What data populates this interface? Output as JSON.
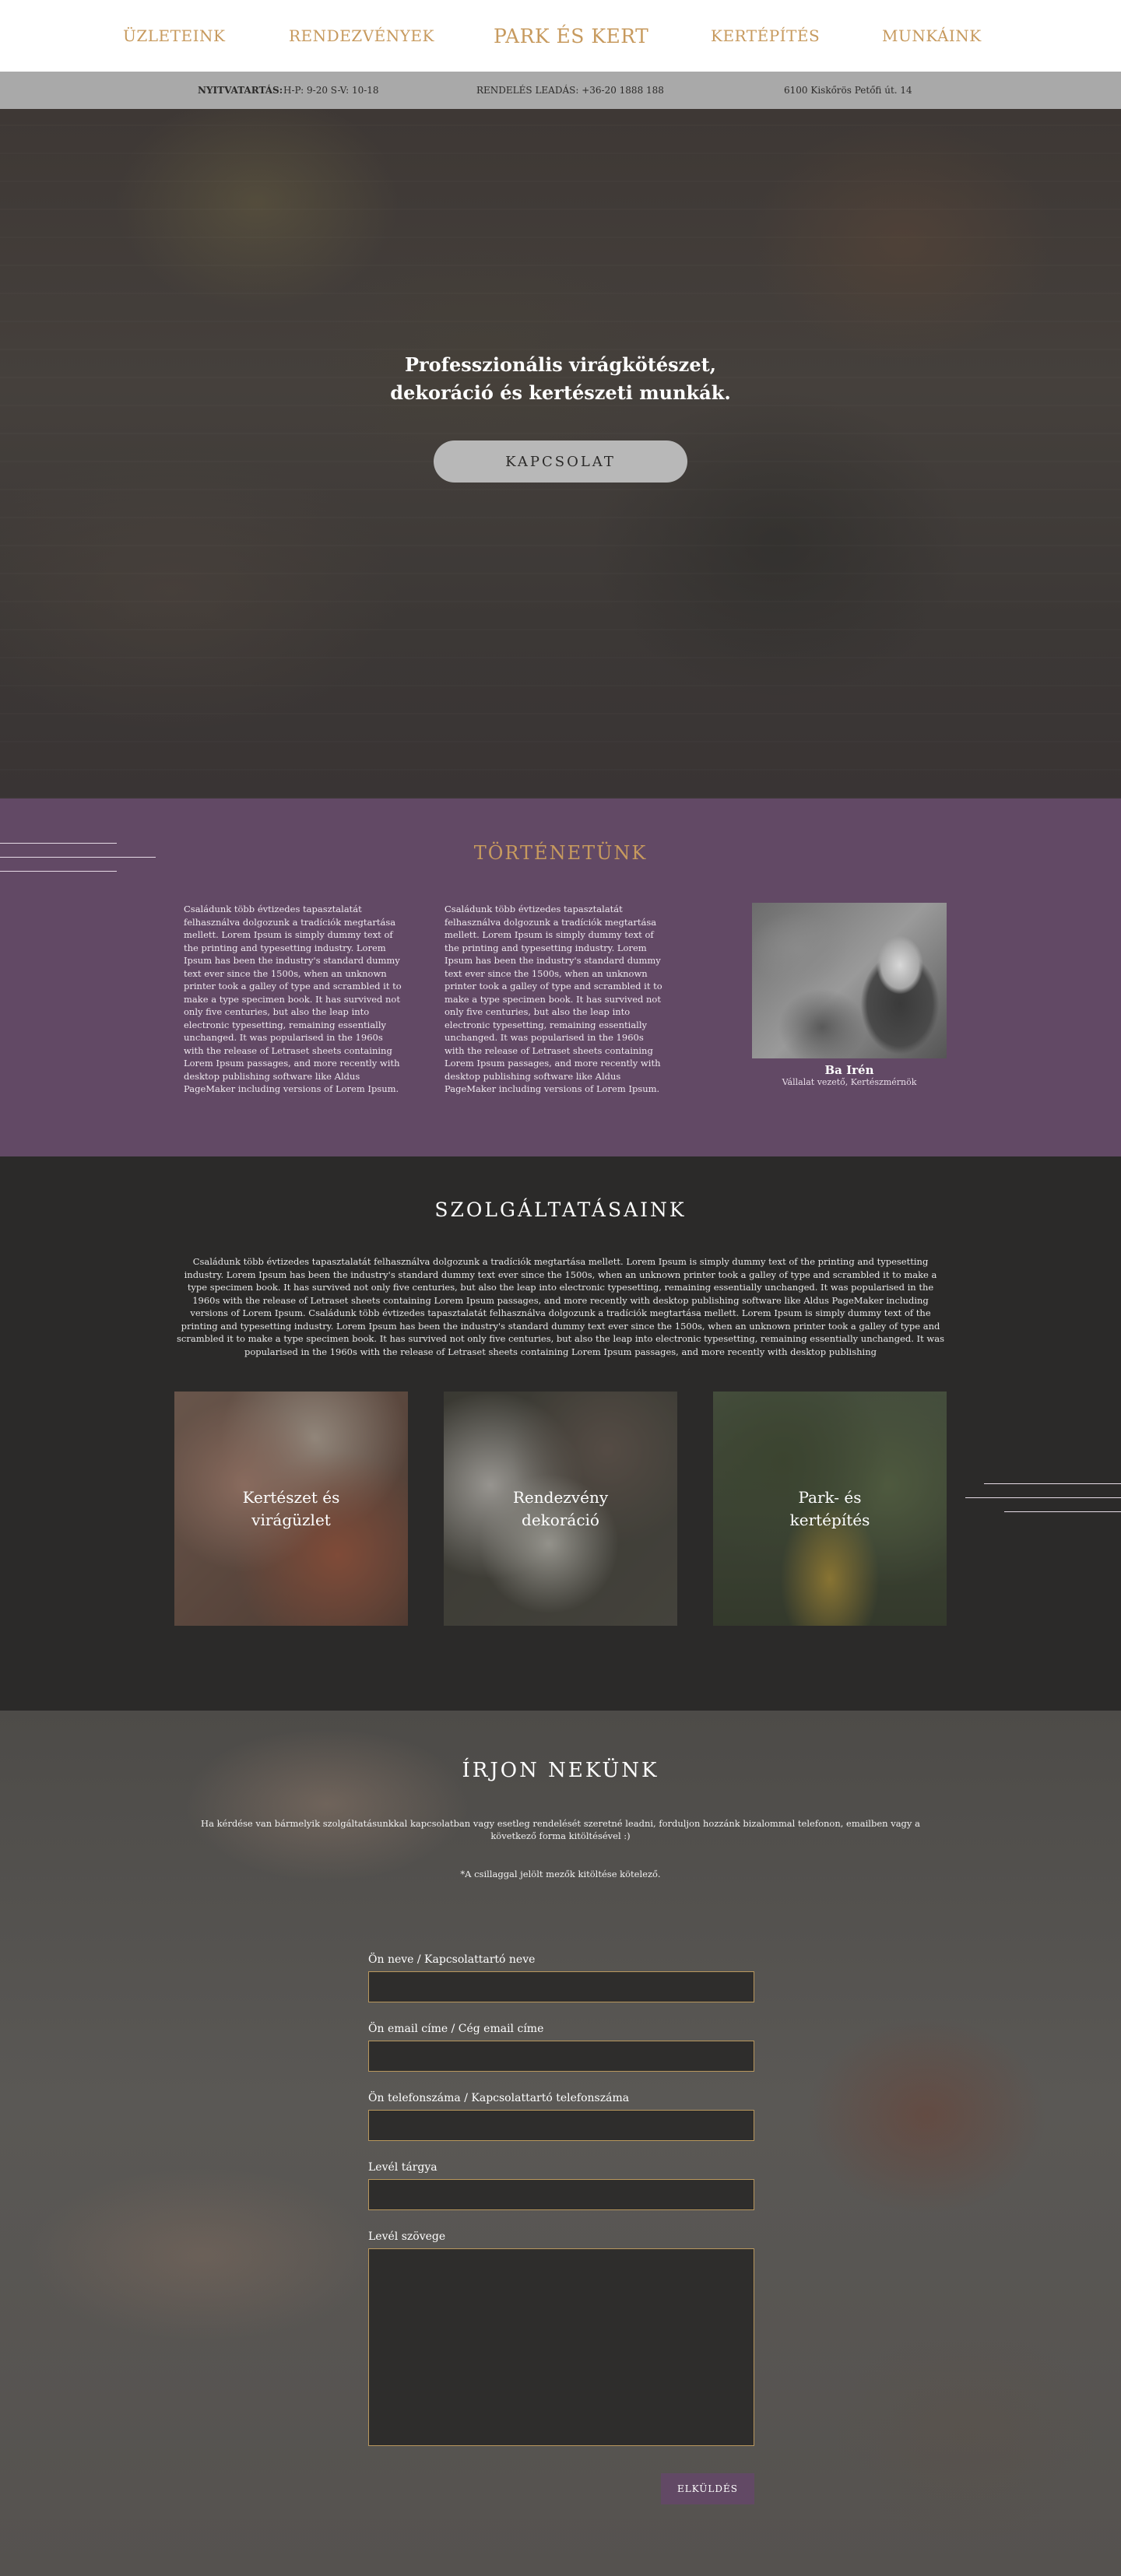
{
  "nav": {
    "items": [
      "ÜZLETEINK",
      "RENDEZVÉNYEK",
      "PARK ÉS KERT",
      "KERTÉPÍTÉS",
      "MUNKÁINK"
    ]
  },
  "infobar": {
    "hours_label": "NYITVATARTÁS:",
    "hours_value": "H-P: 9-20 S-V: 10-18",
    "order": "RENDELÉS LEADÁS: +36-20 1888 188",
    "address": "6100 Kiskőrös Petőfi út. 14"
  },
  "hero": {
    "title": "Professzionális virágkötészet, dekoráció és kertészeti munkák.",
    "button": "KAPCSOLAT"
  },
  "story": {
    "title": "TÖRTÉNETÜNK",
    "col1": "Családunk több évtizedes tapasztalatát  felhasználva dolgozunk a tradíciók megtartása mellett. Lorem Ipsum is simply dummy text of the printing and typesetting industry. Lorem Ipsum has been the industry's standard dummy text ever since the 1500s, when an unknown printer took a galley of type and scrambled it to make a type specimen book. It has survived not only five centuries, but also the leap into electronic typesetting, remaining essentially unchanged. It was popularised in the 1960s with the release of Letraset sheets containing Lorem Ipsum passages, and more recently with desktop publishing software like Aldus PageMaker including versions of Lorem Ipsum.",
    "col2": "Családunk több évtizedes tapasztalatát  felhasználva dolgozunk a tradíciók megtartása mellett. Lorem Ipsum is simply dummy text of the printing and typesetting industry. Lorem Ipsum has been the industry's standard dummy text ever since the 1500s, when an unknown printer took a galley of type and scrambled it to make a type specimen book. It has survived not only five centuries, but also the leap into electronic typesetting, remaining essentially unchanged. It was popularised in the 1960s with the release of Letraset sheets containing Lorem Ipsum passages, and more recently with desktop publishing software like Aldus PageMaker including versions of Lorem Ipsum.",
    "person_name": "Ba Irén",
    "person_role": "Vállalat vezető, Kertészmérnök"
  },
  "services": {
    "title": "SZOLGÁLTATÁSAINK",
    "text": "Családunk több évtizedes tapasztalatát  felhasználva dolgozunk a tradíciók megtartása mellett. Lorem Ipsum is simply dummy text of the printing and typesetting industry. Lorem Ipsum has been the industry's standard dummy text ever since the 1500s, when an unknown printer took a galley of type and scrambled it to make a type specimen book. It has survived not only five centuries, but also the leap into electronic typesetting, remaining essentially unchanged. It was popularised in the 1960s with the release of Letraset sheets containing Lorem Ipsum passages, and more recently with desktop publishing software like Aldus PageMaker including versions of Lorem Ipsum.  Családunk több évtizedes tapasztalatát  felhasználva dolgozunk a tradíciók megtartása mellett. Lorem Ipsum is simply dummy text of the printing and typesetting industry. Lorem Ipsum has been the industry's standard dummy text ever since the 1500s, when an unknown printer took a galley of type and scrambled it to make a type specimen book. It has survived not only five centuries, but also the leap into electronic typesetting, remaining essentially unchanged. It was popularised in the 1960s with the release of Letraset sheets containing Lorem Ipsum passages, and more recently with desktop publishing",
    "cards": [
      {
        "line1": "Kertészet és",
        "line2": "virágüzlet"
      },
      {
        "line1": "Rendezvény",
        "line2": "dekoráció"
      },
      {
        "line1": "Park- és",
        "line2": "kertépítés"
      }
    ]
  },
  "contact": {
    "title": "ÍRJON NEKÜNK",
    "intro": "Ha kérdése van bármelyik szolgáltatásunkkal kapcsolatban vagy esetleg rendelését szeretné leadni, forduljon hozzánk bizalommal telefonon, emailben  vagy a következő forma kitöltésével :)",
    "note": "*A csillaggal jelölt mezők kitöltése kötelező.",
    "labels": {
      "name": "Ön neve / Kapcsolattartó neve",
      "email": "Ön email címe / Cég email címe",
      "phone": "Ön telefonszáma / Kapcsolattartó telefonszáma",
      "subject": "Levél tárgya",
      "message": "Levél szövege"
    },
    "submit": "ELKÜLDÉS"
  },
  "colors": {
    "accent_gold": "#c79a5e",
    "story_purple": "#624965",
    "dark_bg": "#2b2a29",
    "infobar_gray": "#a9a9a9"
  }
}
